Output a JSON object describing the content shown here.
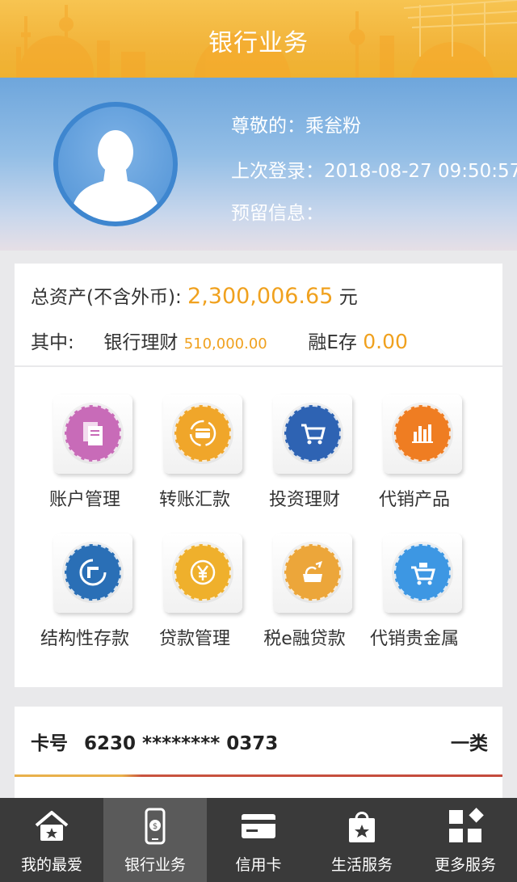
{
  "header": {
    "title": "银行业务"
  },
  "profile": {
    "greeting": "尊敬的：乘瓮粉",
    "last_login": "上次登录：2018-08-27 09:50:57",
    "reserved_info": "预留信息："
  },
  "assets": {
    "total_label": "总资产(不含外币):",
    "total_value": "2,300,006.65",
    "total_unit": "元",
    "of_which_label": "其中:",
    "wealth_label": "银行理财",
    "wealth_value": "510,000.00",
    "rongE_label": "融E存",
    "rongE_value": "0.00"
  },
  "services": [
    {
      "label": "账户管理",
      "icon": "account-document-icon",
      "color": "#c86bb8"
    },
    {
      "label": "转账汇款",
      "icon": "transfer-card-icon",
      "color": "#f0a62a"
    },
    {
      "label": "投资理财",
      "icon": "shopping-cart-icon",
      "color": "#2e63b3"
    },
    {
      "label": "代销产品",
      "icon": "bar-chart-icon",
      "color": "#ef7d22"
    },
    {
      "label": "结构性存款",
      "icon": "structured-deposit-icon",
      "color": "#2a6fb6"
    },
    {
      "label": "贷款管理",
      "icon": "yuan-coin-icon",
      "color": "#efb02c"
    },
    {
      "label": "税e融贷款",
      "icon": "tax-loan-icon",
      "color": "#eca63a"
    },
    {
      "label": "代销贵金属",
      "icon": "precious-metal-cart-icon",
      "color": "#3d97e3"
    }
  ],
  "card": {
    "label": "卡号",
    "number": "6230 ******** 0373",
    "type": "一类"
  },
  "nav": [
    {
      "label": "我的最爱",
      "icon": "favorite-home-icon",
      "active": false
    },
    {
      "label": "银行业务",
      "icon": "phone-banking-icon",
      "active": true
    },
    {
      "label": "信用卡",
      "icon": "credit-card-icon",
      "active": false
    },
    {
      "label": "生活服务",
      "icon": "shopping-bag-star-icon",
      "active": false
    },
    {
      "label": "更多服务",
      "icon": "grid-more-icon",
      "active": false
    }
  ]
}
